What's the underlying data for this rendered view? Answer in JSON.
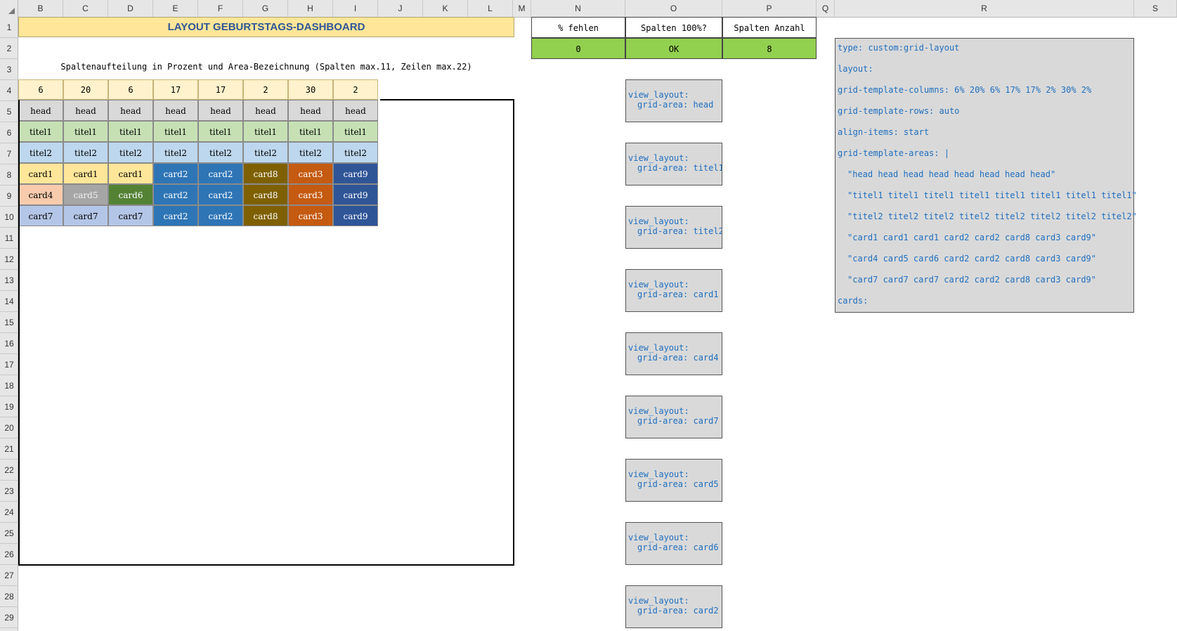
{
  "spreadsheet": {
    "column_letters": [
      "B",
      "C",
      "D",
      "E",
      "F",
      "G",
      "H",
      "I",
      "J",
      "K",
      "L",
      "M",
      "N",
      "O",
      "P",
      "Q",
      "R",
      "S"
    ],
    "row_numbers": [
      "1",
      "2",
      "3",
      "4",
      "5",
      "6",
      "7",
      "8",
      "9",
      "10",
      "11",
      "12",
      "13",
      "14",
      "15",
      "16",
      "17",
      "18",
      "19",
      "20",
      "21",
      "22",
      "23",
      "24",
      "25",
      "26",
      "27",
      "28",
      "29"
    ]
  },
  "dashboard": {
    "title": "LAYOUT GEBURTSTAGS-DASHBOARD",
    "subtitle": "Spaltenaufteilung in Prozent und Area-Bezeichnung (Spalten max.11, Zeilen max.22)",
    "percentages": [
      "6",
      "20",
      "6",
      "17",
      "17",
      "2",
      "30",
      "2"
    ],
    "rows": [
      [
        "head",
        "head",
        "head",
        "head",
        "head",
        "head",
        "head",
        "head"
      ],
      [
        "titel1",
        "titel1",
        "titel1",
        "titel1",
        "titel1",
        "titel1",
        "titel1",
        "titel1"
      ],
      [
        "titel2",
        "titel2",
        "titel2",
        "titel2",
        "titel2",
        "titel2",
        "titel2",
        "titel2"
      ],
      [
        "card1",
        "card1",
        "card1",
        "card2",
        "card2",
        "card8",
        "card3",
        "card9"
      ],
      [
        "card4",
        "card5",
        "card6",
        "card2",
        "card2",
        "card8",
        "card3",
        "card9"
      ],
      [
        "card7",
        "card7",
        "card7",
        "card2",
        "card2",
        "card8",
        "card3",
        "card9"
      ]
    ],
    "area_colors": {
      "head": "#d9d9d9",
      "titel1": "#c6e0b4",
      "titel2": "#bdd7ee",
      "card1": "#ffe699",
      "card2": "#2e75b6",
      "card3": "#c55a11",
      "card4": "#f8cbad",
      "card5": "#a6a6a6",
      "card6": "#548235",
      "card7": "#b4c6e7",
      "card8": "#7f6000",
      "card9": "#2f5597"
    }
  },
  "status": {
    "headers": [
      "% fehlen",
      "Spalten 100%?",
      "Spalten Anzahl"
    ],
    "values": [
      "0",
      "OK",
      "8"
    ]
  },
  "view_layouts": [
    {
      "line1": "view_layout:",
      "line2": "grid-area: head"
    },
    {
      "line1": "view_layout:",
      "line2": "grid-area: titel1"
    },
    {
      "line1": "view_layout:",
      "line2": "grid-area: titel2"
    },
    {
      "line1": "view_layout:",
      "line2": "grid-area: card1"
    },
    {
      "line1": "view_layout:",
      "line2": "grid-area: card4"
    },
    {
      "line1": "view_layout:",
      "line2": "grid-area: card7"
    },
    {
      "line1": "view_layout:",
      "line2": "grid-area: card5"
    },
    {
      "line1": "view_layout:",
      "line2": "grid-area: card6"
    },
    {
      "line1": "view_layout:",
      "line2": "grid-area: card2"
    }
  ],
  "yaml": [
    "type: custom:grid-layout",
    "layout:",
    "grid-template-columns: 6% 20% 6% 17% 17% 2% 30% 2%",
    "grid-template-rows: auto",
    "align-items: start",
    "grid-template-areas: |",
    "\"head head head head head head head head\"",
    "\"titel1 titel1 titel1 titel1 titel1 titel1 titel1 titel1\"",
    "\"titel2 titel2 titel2 titel2 titel2 titel2 titel2 titel2\"",
    "\"card1 card1 card1 card2 card2 card8 card3 card9\"",
    "\"card4 card5 card6 card2 card2 card8 card3 card9\"",
    "\"card7 card7 card7 card2 card2 card8 card3 card9\"",
    "cards:"
  ]
}
